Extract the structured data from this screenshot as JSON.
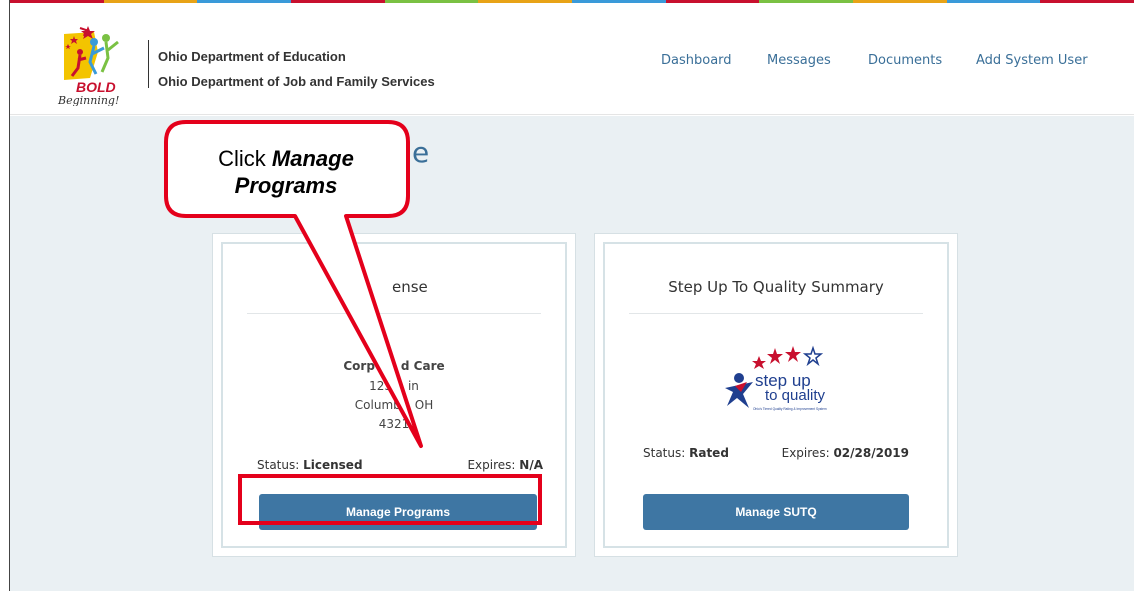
{
  "header": {
    "logo_text": "BOLD Beginning!",
    "agency_line1": "Ohio Department of Education",
    "agency_line2": "Ohio Department of Job and Family Services",
    "nav": [
      "Dashboard",
      "Messages",
      "Documents",
      "Add System User"
    ]
  },
  "main": {
    "page_title_partial": "e"
  },
  "callout": {
    "prefix": "Click ",
    "emphasis_line1": "Manage",
    "emphasis_line2": "Programs"
  },
  "license_card": {
    "title_partial": "ense",
    "name_partial_1": "Corp",
    "name_partial_2": "d Care",
    "addr1_partial_1": "123",
    "addr1_partial_2": "in",
    "addr2_partial_1": "Columb",
    "addr2_partial_2": "OH",
    "addr3_partial": "4321",
    "status_label": "Status:",
    "status_value": "Licensed",
    "expires_label": "Expires:",
    "expires_value": "N/A",
    "button_label": "Manage Programs"
  },
  "sutq_card": {
    "title": "Step Up To Quality Summary",
    "logo_text_1": "step up",
    "logo_text_2": "to quality",
    "logo_subtext": "Ohio's Tiered Quality Rating & Improvement System",
    "status_label": "Status:",
    "status_value": "Rated",
    "expires_label": "Expires:",
    "expires_value": "02/28/2019",
    "button_label": "Manage SUTQ"
  },
  "colors": {
    "accent_blue": "#3e76a3",
    "nav_link": "#3a6f98",
    "callout_red": "#e4001b",
    "page_bg": "#eaf0f3"
  }
}
